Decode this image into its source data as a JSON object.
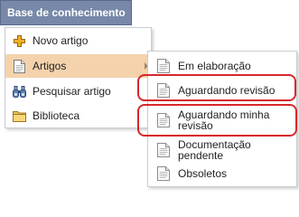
{
  "header": {
    "title": "Base de conhecimento"
  },
  "main_menu": {
    "items": [
      {
        "label": "Novo artigo",
        "icon": "plus-icon"
      },
      {
        "label": "Artigos",
        "icon": "document-icon",
        "active": true
      },
      {
        "label": "Pesquisar artigo",
        "icon": "binoculars-icon"
      },
      {
        "label": "Biblioteca",
        "icon": "folder-icon"
      }
    ]
  },
  "sub_menu": {
    "items": [
      {
        "label": "Em elaboração",
        "icon": "document-icon"
      },
      {
        "label": "Aguardando revisão",
        "icon": "document-icon"
      },
      {
        "label": "Aguardando minha revisão",
        "icon": "document-icon"
      },
      {
        "label": "Documentação pendente",
        "icon": "document-icon"
      },
      {
        "label": "Obsoletos",
        "icon": "document-icon"
      }
    ]
  },
  "colors": {
    "header_bg": "#7788a8",
    "active_bg": "#f4d3ac",
    "highlight": "#d7272b"
  }
}
